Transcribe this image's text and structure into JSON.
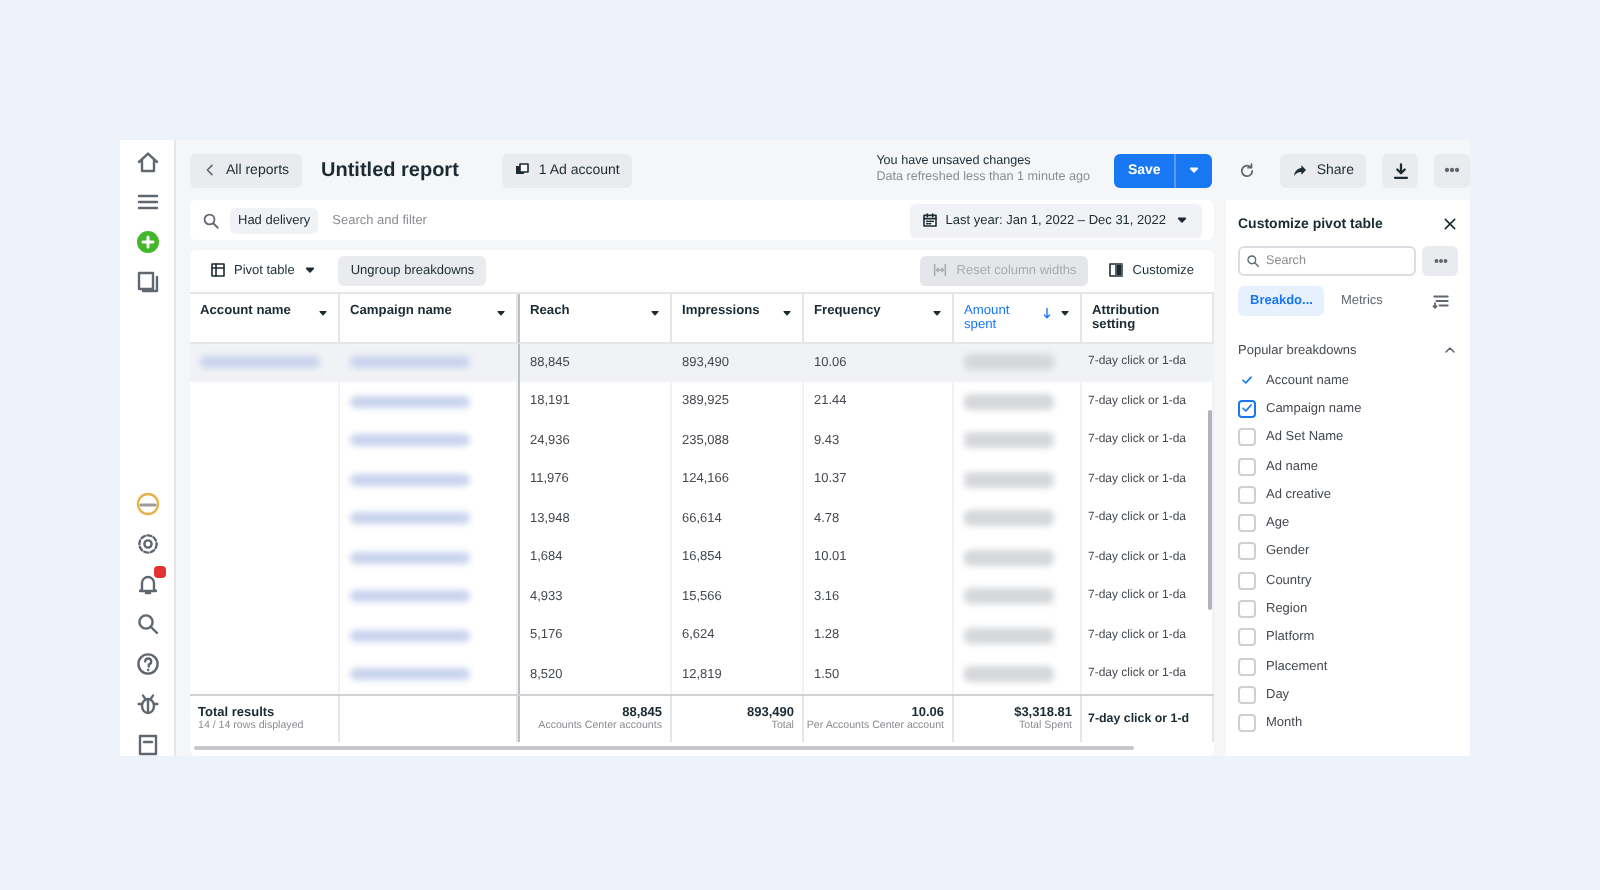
{
  "header": {
    "back_label": "All reports",
    "title": "Untitled report",
    "account_chip": "1 Ad account",
    "status": "You have unsaved changes",
    "refresh_note": "Data refreshed less than 1 minute ago",
    "save": "Save",
    "share": "Share"
  },
  "filter_bar": {
    "chip": "Had delivery",
    "placeholder": "Search and filter",
    "date_range": "Last year: Jan 1, 2022 – Dec 31, 2022"
  },
  "toolbar": {
    "pivot": "Pivot table",
    "ungroup": "Ungroup breakdowns",
    "reset": "Reset column widths",
    "reset_disabled": true,
    "customize": "Customize"
  },
  "table": {
    "columns": [
      {
        "label": "Account name",
        "sorted": false,
        "menu": true
      },
      {
        "label": "Campaign name",
        "sorted": false,
        "menu": true
      },
      {
        "label": "Reach",
        "sorted": false,
        "menu": true
      },
      {
        "label": "Impressions",
        "sorted": false,
        "menu": true
      },
      {
        "label": "Frequency",
        "sorted": false,
        "menu": true
      },
      {
        "label": "Amount spent",
        "sorted": true,
        "menu": true
      },
      {
        "label": "Attribution setting",
        "sorted": false,
        "menu": false
      }
    ],
    "rows": [
      {
        "highlighted": true,
        "account_blurred": true,
        "campaign_blurred": true,
        "amount_blurred": true,
        "reach": "88,845",
        "impressions": "893,490",
        "frequency": "10.06",
        "attribution": "7-day click or 1-da"
      },
      {
        "highlighted": false,
        "account_blurred": false,
        "campaign_blurred": true,
        "amount_blurred": true,
        "reach": "18,191",
        "impressions": "389,925",
        "frequency": "21.44",
        "attribution": "7-day click or 1-da"
      },
      {
        "highlighted": false,
        "account_blurred": false,
        "campaign_blurred": true,
        "amount_blurred": true,
        "reach": "24,936",
        "impressions": "235,088",
        "frequency": "9.43",
        "attribution": "7-day click or 1-da"
      },
      {
        "highlighted": false,
        "account_blurred": false,
        "campaign_blurred": true,
        "amount_blurred": true,
        "reach": "11,976",
        "impressions": "124,166",
        "frequency": "10.37",
        "attribution": "7-day click or 1-da"
      },
      {
        "highlighted": false,
        "account_blurred": false,
        "campaign_blurred": true,
        "amount_blurred": true,
        "reach": "13,948",
        "impressions": "66,614",
        "frequency": "4.78",
        "attribution": "7-day click or 1-da"
      },
      {
        "highlighted": false,
        "account_blurred": false,
        "campaign_blurred": true,
        "amount_blurred": true,
        "reach": "1,684",
        "impressions": "16,854",
        "frequency": "10.01",
        "attribution": "7-day click or 1-da"
      },
      {
        "highlighted": false,
        "account_blurred": false,
        "campaign_blurred": true,
        "amount_blurred": true,
        "reach": "4,933",
        "impressions": "15,566",
        "frequency": "3.16",
        "attribution": "7-day click or 1-da"
      },
      {
        "highlighted": false,
        "account_blurred": false,
        "campaign_blurred": true,
        "amount_blurred": true,
        "reach": "5,176",
        "impressions": "6,624",
        "frequency": "1.28",
        "attribution": "7-day click or 1-da"
      },
      {
        "highlighted": false,
        "account_blurred": false,
        "campaign_blurred": true,
        "amount_blurred": true,
        "reach": "8,520",
        "impressions": "12,819",
        "frequency": "1.50",
        "attribution": "7-day click or 1-da"
      }
    ],
    "totals": {
      "label": "Total results",
      "rows_note": "14 / 14 rows displayed",
      "cells": [
        {
          "value": "88,845",
          "note": "Accounts Center accounts"
        },
        {
          "value": "893,490",
          "note": "Total"
        },
        {
          "value": "10.06",
          "note": "Per Accounts Center account"
        },
        {
          "value": "$3,318.81",
          "note": "Total Spent"
        }
      ],
      "attribution": "7-day click or 1-d"
    }
  },
  "panel": {
    "title": "Customize pivot table",
    "search_placeholder": "Search",
    "tabs": [
      {
        "label": "Breakdo...",
        "selected": true
      },
      {
        "label": "Metrics",
        "selected": false
      }
    ],
    "section": "Popular breakdowns",
    "section_expanded": true,
    "items": [
      {
        "label": "Account name",
        "checked": true,
        "locked": true
      },
      {
        "label": "Campaign name",
        "checked": true,
        "locked": false
      },
      {
        "label": "Ad Set Name",
        "checked": false,
        "locked": false
      },
      {
        "label": "Ad name",
        "checked": false,
        "locked": false
      },
      {
        "label": "Ad creative",
        "checked": false,
        "locked": false
      },
      {
        "label": "Age",
        "checked": false,
        "locked": false
      },
      {
        "label": "Gender",
        "checked": false,
        "locked": false
      },
      {
        "label": "Country",
        "checked": false,
        "locked": false
      },
      {
        "label": "Region",
        "checked": false,
        "locked": false
      },
      {
        "label": "Platform",
        "checked": false,
        "locked": false
      },
      {
        "label": "Placement",
        "checked": false,
        "locked": false
      },
      {
        "label": "Day",
        "checked": false,
        "locked": false
      },
      {
        "label": "Month",
        "checked": false,
        "locked": false
      }
    ]
  },
  "nav": {
    "notification_badge": true
  }
}
